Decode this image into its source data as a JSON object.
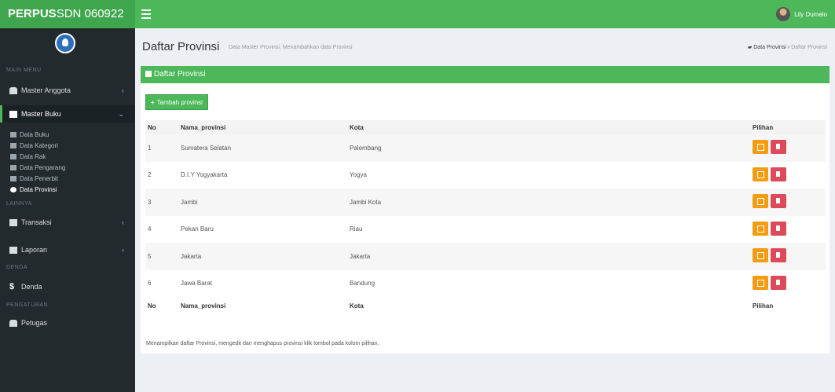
{
  "app": {
    "brand_bold": "PERPUS",
    "brand_rest": "SDN 060922",
    "user_name": "Lily Dumelo"
  },
  "sidebar": {
    "headers": [
      "MAIN MENU",
      "LAINNYA",
      "DENDA",
      "PENGATURAN"
    ],
    "items": [
      {
        "label": "Master Anggota",
        "icon": "users-icon"
      },
      {
        "label": "Master Buku",
        "icon": "book-icon"
      },
      {
        "label": "Transaksi",
        "icon": "transaction-icon"
      },
      {
        "label": "Laporan",
        "icon": "report-icon"
      },
      {
        "label": "Denda",
        "icon": "dollar-icon"
      },
      {
        "label": "Petugas",
        "icon": "staff-icon"
      }
    ],
    "sub_items": [
      {
        "label": "Data Buku",
        "icon": "book-icon"
      },
      {
        "label": "Data Kategori",
        "icon": "tags-icon"
      },
      {
        "label": "Data Rak",
        "icon": "shelf-icon"
      },
      {
        "label": "Data Pengarang",
        "icon": "pen-icon"
      },
      {
        "label": "Data Penerbit",
        "icon": "building-icon"
      },
      {
        "label": "Data Provinsi",
        "icon": "globe-icon"
      }
    ]
  },
  "header": {
    "title": "Daftar Provinsi",
    "subtitle": "Data Master Provinsi, Menambahkan data Provinsi",
    "breadcrumb": [
      "Data Provinsi",
      "Daftar Provinsi"
    ]
  },
  "box": {
    "title": "Daftar Provinsi",
    "add_button": "Tambah provinsi",
    "columns": [
      "No",
      "Nama_provinsi",
      "Kota",
      "Pilihan"
    ],
    "rows": [
      {
        "no": "1",
        "provinsi": "Sumatera Selatan",
        "kota": "Palembang"
      },
      {
        "no": "2",
        "provinsi": "D.I.Y Yogyakarta",
        "kota": "Yogya"
      },
      {
        "no": "3",
        "provinsi": "Jambi",
        "kota": "Jambi Kota"
      },
      {
        "no": "4",
        "provinsi": "Pekan Baru",
        "kota": "Riau"
      },
      {
        "no": "5",
        "provinsi": "Jakarta",
        "kota": "Jakarta"
      },
      {
        "no": "6",
        "provinsi": "Jawa Barat",
        "kota": "Bandung"
      }
    ],
    "footnote": "Menampilkan daftar Provinsi, mengedit dan menghapus provinsi klik tombol pada kolom pilihan."
  },
  "colors": {
    "primary": "#4cb85a",
    "sidebar": "#232a2d",
    "edit": "#f39c12",
    "delete": "#dd4b5a"
  }
}
